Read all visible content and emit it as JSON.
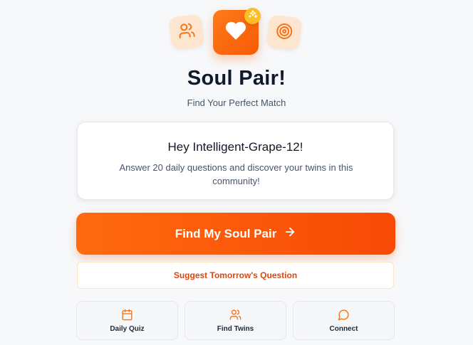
{
  "app": {
    "title": "Soul Pair!",
    "subtitle": "Find Your Perfect Match"
  },
  "hero_icons": {
    "left": "users-icon",
    "center": "heart-icon",
    "badge": "sparkles-icon",
    "right": "target-icon"
  },
  "welcome_card": {
    "greeting": "Hey Intelligent-Grape-12!",
    "description": "Answer 20 daily questions and discover your twins in this community!"
  },
  "primary_action": {
    "label": "Find My Soul Pair",
    "icon": "arrow-right-icon"
  },
  "secondary_action": {
    "label": "Suggest Tomorrow's Question"
  },
  "nav": [
    {
      "label": "Daily Quiz",
      "icon": "calendar-icon"
    },
    {
      "label": "Find Twins",
      "icon": "users-icon"
    },
    {
      "label": "Connect",
      "icon": "chat-bubble-icon"
    }
  ],
  "colors": {
    "accent": "#f97316",
    "accent_dark": "#f74a05",
    "badge": "#fbbf24",
    "tile_bg": "#fde6cf",
    "title": "#0f1b2d",
    "suggest_text": "#d9480f"
  }
}
